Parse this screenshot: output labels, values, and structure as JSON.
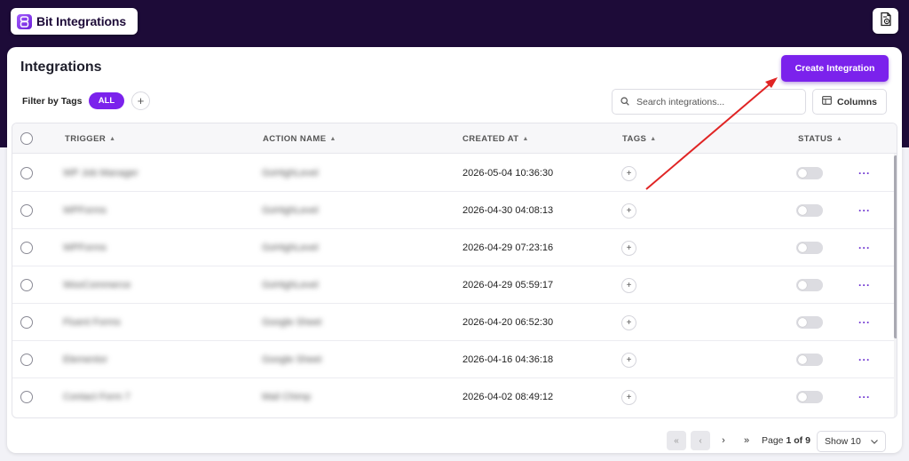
{
  "app": {
    "name": "Bit Integrations"
  },
  "page": {
    "title": "Integrations",
    "create_label": "Create Integration"
  },
  "filter": {
    "label": "Filter by Tags",
    "tags": [
      "ALL"
    ],
    "add_label": "+"
  },
  "search": {
    "placeholder": "Search integrations..."
  },
  "columns_button": {
    "label": "Columns"
  },
  "table": {
    "headers": [
      "TRIGGER",
      "ACTION NAME",
      "CREATED AT",
      "TAGS",
      "STATUS"
    ],
    "rows": [
      {
        "trigger": "WP Job Manager",
        "action": "GoHighLevel",
        "created_at": "2026-05-04 10:36:30"
      },
      {
        "trigger": "WPForms",
        "action": "GoHighLevel",
        "created_at": "2026-04-30 04:08:13"
      },
      {
        "trigger": "WPForms",
        "action": "GoHighLevel",
        "created_at": "2026-04-29 07:23:16"
      },
      {
        "trigger": "WooCommerce",
        "action": "GoHighLevel",
        "created_at": "2026-04-29 05:59:17"
      },
      {
        "trigger": "Fluent Forms",
        "action": "Google Sheet",
        "created_at": "2026-04-20 06:52:30"
      },
      {
        "trigger": "Elementor",
        "action": "Google Sheet",
        "created_at": "2026-04-16 04:36:18"
      },
      {
        "trigger": "Contact Form 7",
        "action": "Mail Chimp",
        "created_at": "2026-04-02 08:49:12"
      }
    ]
  },
  "pagination": {
    "page_prefix": "Page",
    "current": "1",
    "of_label": "of",
    "total": "9",
    "show_label": "Show 10"
  },
  "colors": {
    "accent": "#7b22ec",
    "topbar": "#1d0b38",
    "annotation_arrow": "#e02424"
  }
}
